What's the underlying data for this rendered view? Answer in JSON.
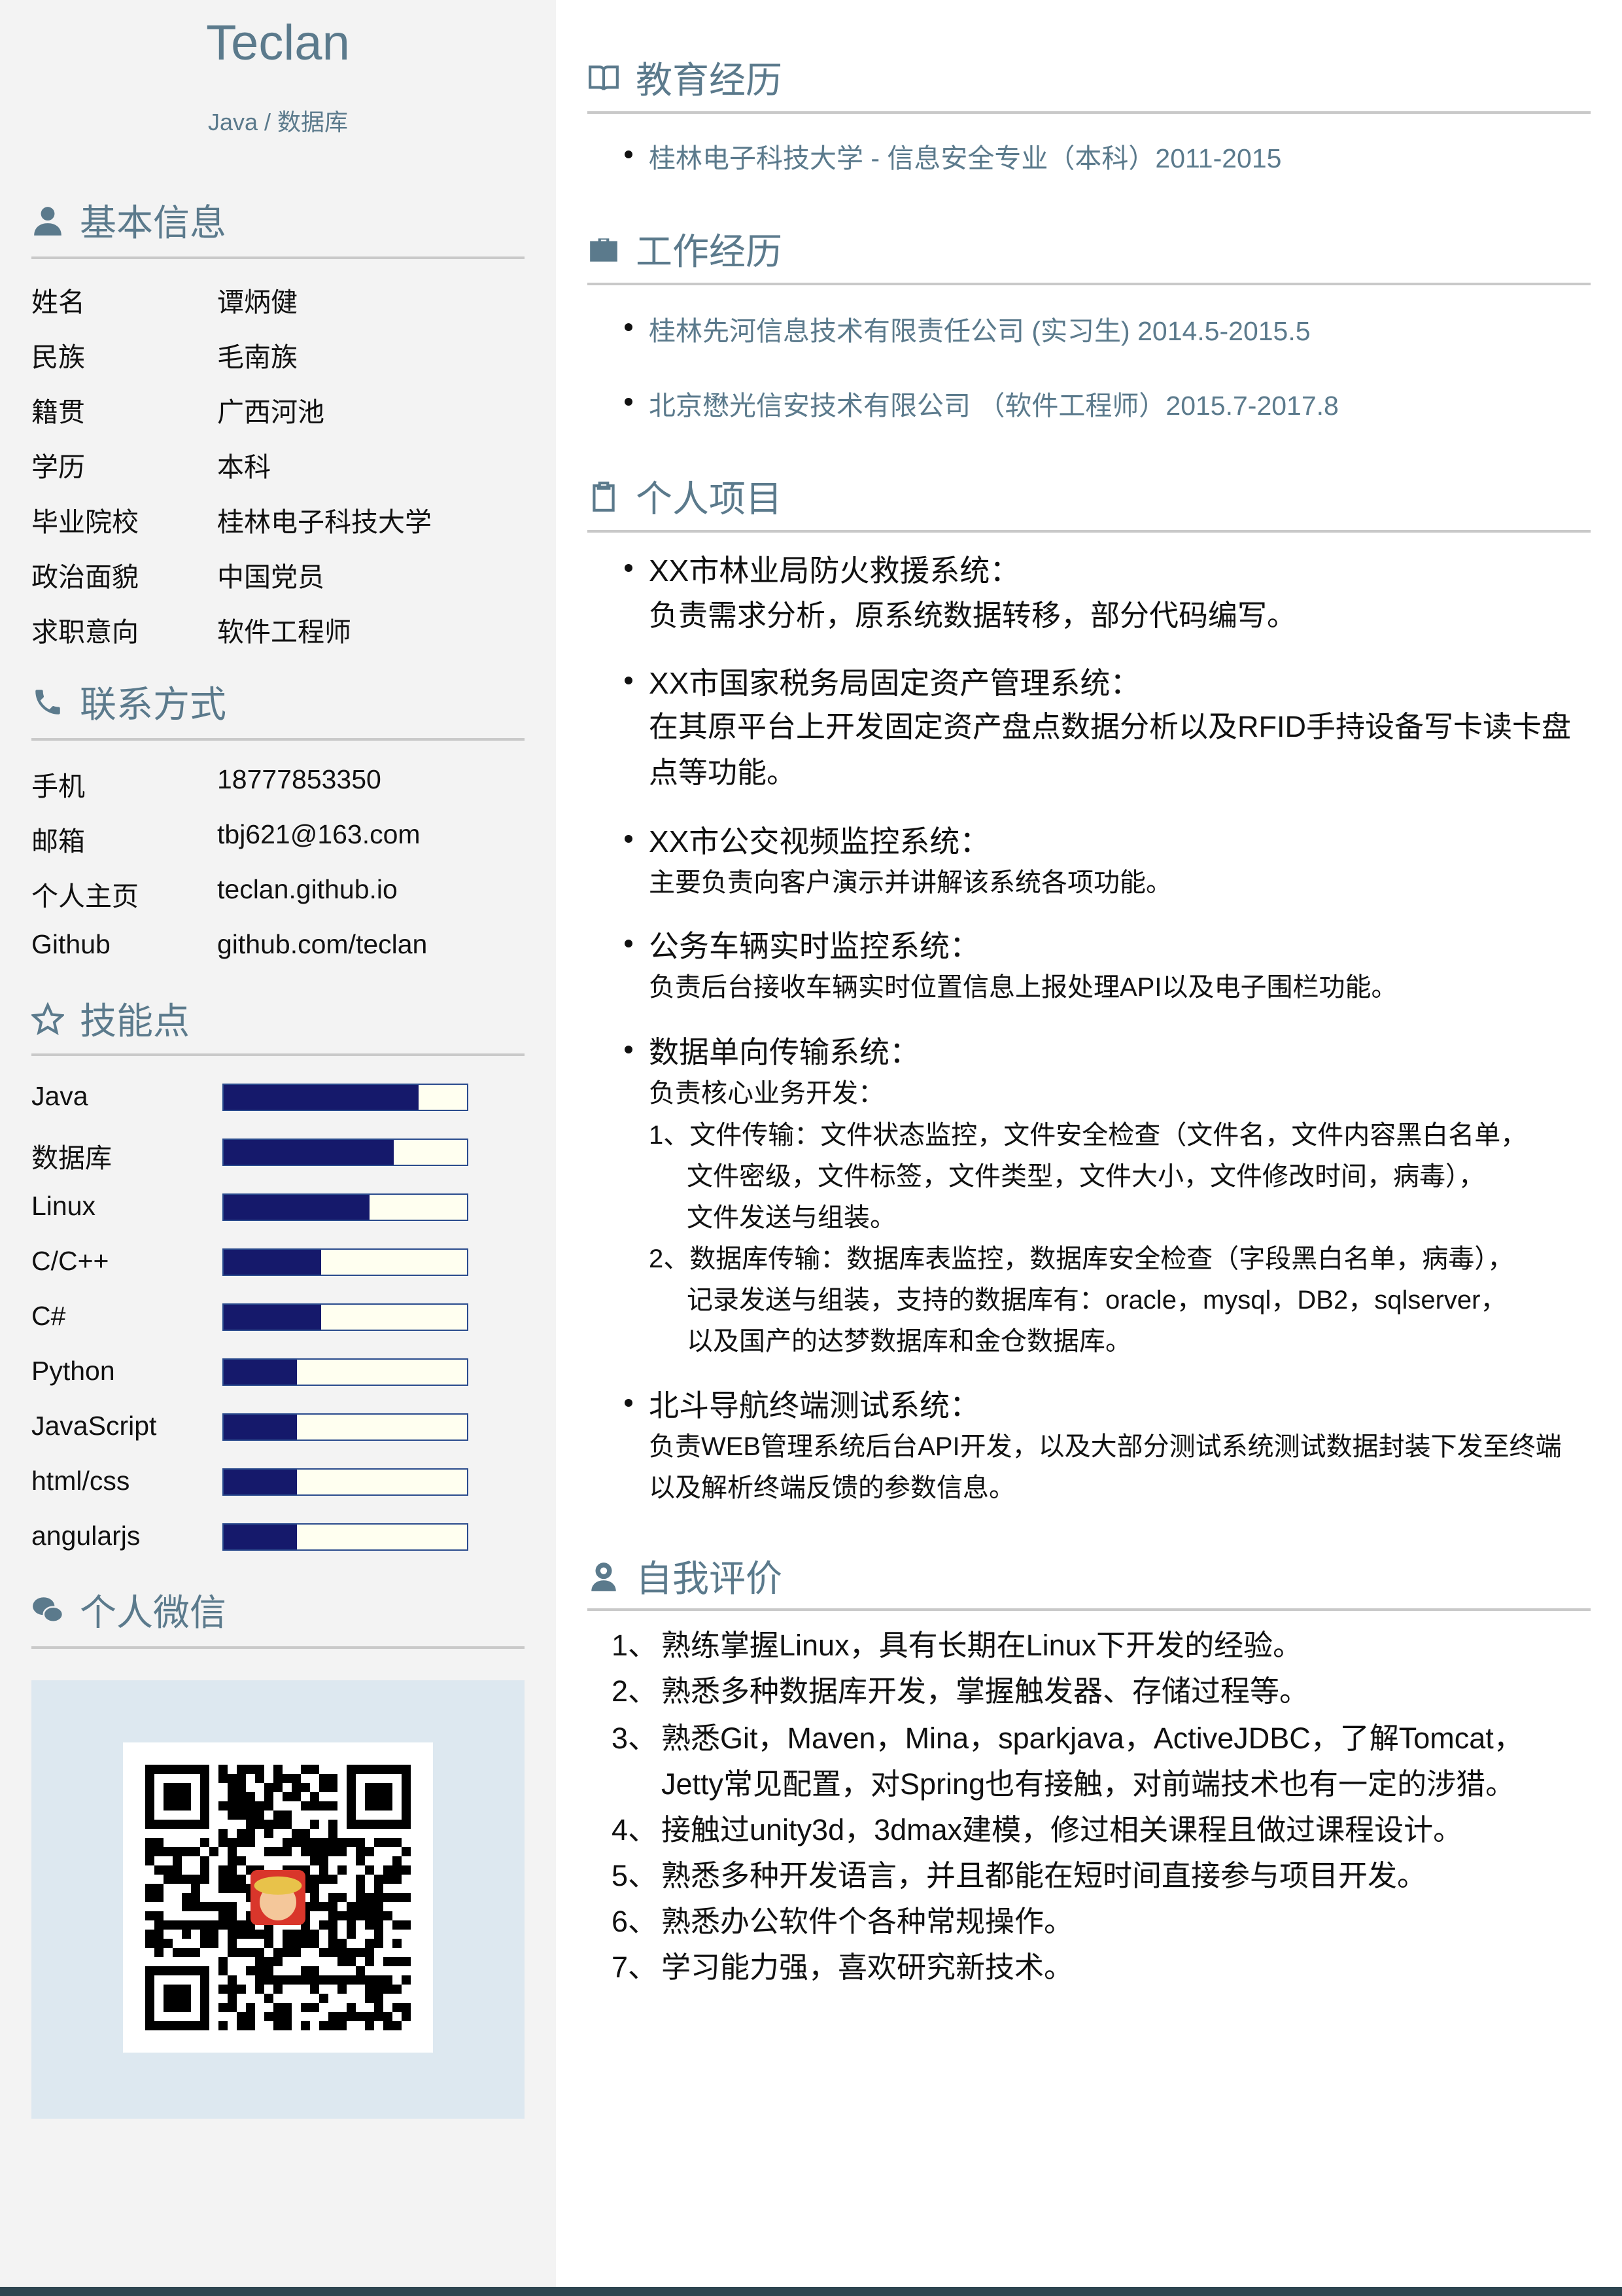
{
  "header": {
    "name": "Teclan",
    "subtitle": "Java / 数据库"
  },
  "basic_info": {
    "title": "基本信息",
    "rows": [
      {
        "k": "姓名",
        "v": "谭炳健"
      },
      {
        "k": "民族",
        "v": "毛南族"
      },
      {
        "k": "籍贯",
        "v": "广西河池"
      },
      {
        "k": "学历",
        "v": "本科"
      },
      {
        "k": "毕业院校",
        "v": "桂林电子科技大学"
      },
      {
        "k": "政治面貌",
        "v": "中国党员"
      },
      {
        "k": "求职意向",
        "v": "软件工程师"
      }
    ]
  },
  "contact": {
    "title": "联系方式",
    "rows": [
      {
        "k": "手机",
        "v": "18777853350"
      },
      {
        "k": "邮箱",
        "v": "tbj621@163.com"
      },
      {
        "k": "个人主页",
        "v": "teclan.github.io"
      },
      {
        "k": "Github",
        "v": "github.com/teclan"
      }
    ]
  },
  "skills": {
    "title": "技能点",
    "items": [
      {
        "name": "Java",
        "level": 0.8
      },
      {
        "name": "数据库",
        "level": 0.7
      },
      {
        "name": "Linux",
        "level": 0.6
      },
      {
        "name": "C/C++",
        "level": 0.4
      },
      {
        "name": "C#",
        "level": 0.4
      },
      {
        "name": "Python",
        "level": 0.3
      },
      {
        "name": "JavaScript",
        "level": 0.3
      },
      {
        "name": "html/css",
        "level": 0.3
      },
      {
        "name": "angularjs",
        "level": 0.3
      }
    ]
  },
  "wechat": {
    "title": "个人微信"
  },
  "education": {
    "title": "教育经历",
    "items": [
      "桂林电子科技大学 - 信息安全专业（本科）2011-2015"
    ]
  },
  "work": {
    "title": "工作经历",
    "items": [
      "桂林先河信息技术有限责任公司 (实习生) 2014.5-2015.5",
      "北京懋光信安技术有限公司 （软件工程师）2015.7-2017.8"
    ]
  },
  "projects": {
    "title": "个人项目",
    "items": [
      {
        "title": "XX市林业局防火救援系统：",
        "desc": " 负责需求分析，原系统数据转移，部分代码编写。"
      },
      {
        "title": "XX市国家税务局固定资产管理系统：",
        "desc": " 在其原平台上开发固定资产盘点数据分析以及RFID手持设备写卡读卡盘点等功能。"
      },
      {
        "title": "XX市公交视频监控系统：",
        "desc": "主要负责向客户演示并讲解该系统各项功能。"
      },
      {
        "title": "公务车辆实时监控系统：",
        "desc": "负责后台接收车辆实时位置信息上报处理API以及电子围栏功能。"
      },
      {
        "title": "数据单向传输系统：",
        "desc": "负责核心业务开发：",
        "sub": [
          "1、文件传输：文件状态监控，文件安全检查（文件名，文件内容黑白名单，",
          "文件密级，文件标签，文件类型，文件大小，文件修改时间，病毒），",
          "文件发送与组装。",
          "2、数据库传输：数据库表监控，数据库安全检查（字段黑白名单，病毒），",
          "记录发送与组装，支持的数据库有：oracle，mysql，DB2，sqlserver，",
          "以及国产的达梦数据库和金仓数据库。"
        ]
      },
      {
        "title": "北斗导航终端测试系统：",
        "desc": "负责WEB管理系统后台API开发，以及大部分测试系统测试数据封装下发至终端以及解析终端反馈的参数信息。"
      }
    ]
  },
  "self_eval": {
    "title": "自我评价",
    "items": [
      {
        "n": "1、",
        "t": "熟练掌握Linux，具有长期在Linux下开发的经验。"
      },
      {
        "n": "2、",
        "t": "熟悉多种数据库开发，掌握触发器、存储过程等。"
      },
      {
        "n": "3、",
        "t": "熟悉Git，Maven，Mina，sparkjava，ActiveJDBC，了解Tomcat，Jetty常见配置，对Spring也有接触，对前端技术也有一定的涉猎。"
      },
      {
        "n": "4、",
        "t": "接触过unity3d，3dmax建模，修过相关课程且做过课程设计。"
      },
      {
        "n": "5、",
        "t": "熟悉多种开发语言，并且都能在短时间直接参与项目开发。"
      },
      {
        "n": "6、",
        "t": "熟悉办公软件个各种常规操作。"
      },
      {
        "n": "7、",
        "t": "学习能力强，喜欢研究新技术。"
      }
    ]
  }
}
